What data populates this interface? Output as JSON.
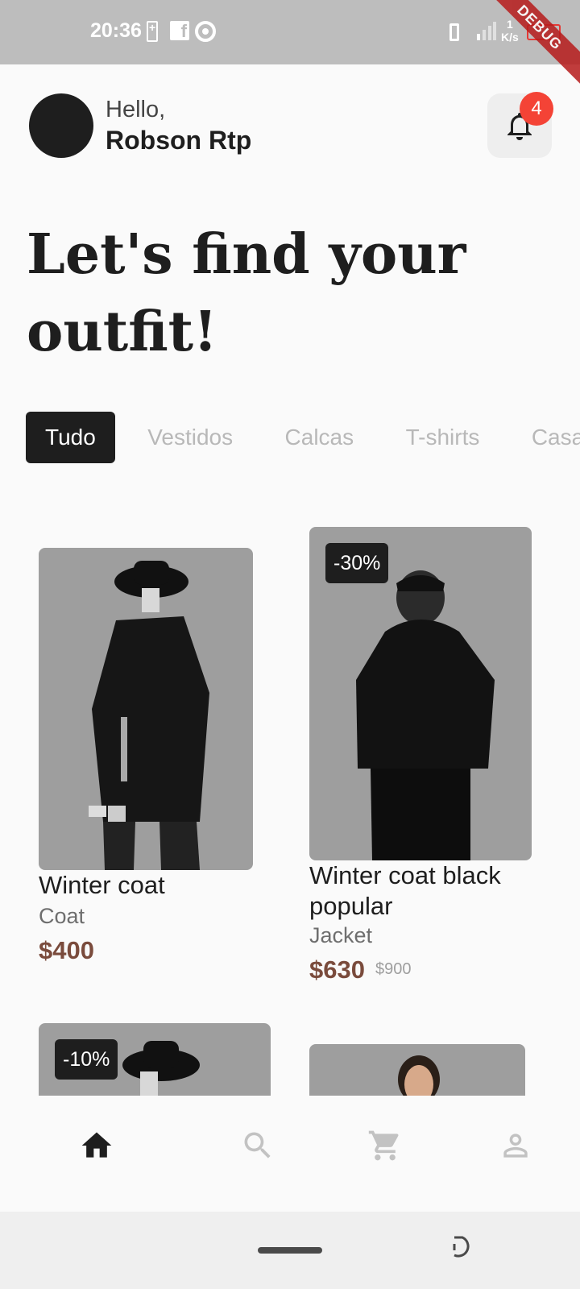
{
  "status": {
    "time": "20:36",
    "net_speed_value": "1",
    "net_speed_unit": "K/s"
  },
  "debug_banner": "DEBUG",
  "header": {
    "greeting": "Hello,",
    "username": "Robson Rtp",
    "notification_count": "4"
  },
  "headline": "Let's find your outfit!",
  "categories": [
    {
      "label": "Tudo",
      "active": true
    },
    {
      "label": "Vestidos",
      "active": false
    },
    {
      "label": "Calcas",
      "active": false
    },
    {
      "label": "T-shirts",
      "active": false
    },
    {
      "label": "Casacos",
      "active": false
    }
  ],
  "products": [
    {
      "name": "Winter coat",
      "category": "Coat",
      "price": "$400",
      "old_price": "",
      "discount": ""
    },
    {
      "name": "Winter coat black popular",
      "category": "Jacket",
      "price": "$630",
      "old_price": "$900",
      "discount": "-30%"
    },
    {
      "name": "",
      "category": "",
      "price": "",
      "old_price": "",
      "discount": "-10%"
    },
    {
      "name": "",
      "category": "",
      "price": "",
      "old_price": "",
      "discount": ""
    }
  ],
  "nav": {
    "items": [
      "home-icon",
      "search-icon",
      "cart-icon",
      "profile-icon"
    ],
    "active": "home-icon"
  },
  "colors": {
    "primary": "#1e1e1e",
    "price": "#7a4b3c",
    "badge": "#f44336",
    "photo_bg": "#9e9e9e"
  }
}
